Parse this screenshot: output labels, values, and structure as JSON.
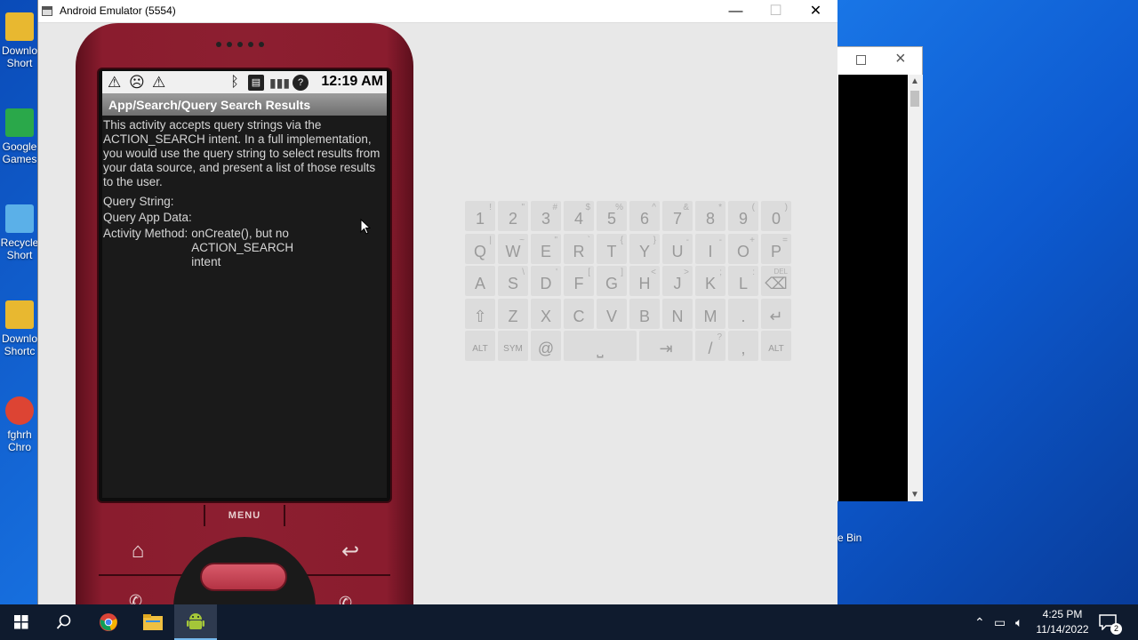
{
  "desktop": {
    "icons": [
      {
        "label1": "Downlo",
        "label2": "Short",
        "color": "#e8b830"
      },
      {
        "label1": "Google",
        "label2": "Games",
        "color": "#2aa84a"
      },
      {
        "label1": "Recycle",
        "label2": "Short",
        "color": "#5bb0e8"
      },
      {
        "label1": "Downlo",
        "label2": "Shortc",
        "color": "#e8b830"
      },
      {
        "label1": "fghrh",
        "label2": "Chro",
        "color": "#dd4433"
      }
    ],
    "recycle_label": "e Bin"
  },
  "emulator_window": {
    "title": "Android Emulator (5554)",
    "minimize": "—",
    "maximize": "☐",
    "close": "✕"
  },
  "phone": {
    "status": {
      "time": "12:19 AM",
      "left_icons": [
        "warning-icon",
        "sad-face-icon",
        "warning-icon"
      ],
      "right_icons": [
        "bluetooth-icon",
        "sim-icon",
        "signal-icon",
        "unknown-icon"
      ]
    },
    "title": "App/Search/Query Search Results",
    "description": "This activity accepts query strings via the ACTION_SEARCH intent. In a full implementation, you would use the query string to select results from your data source, and present a list of those results to the user.",
    "query_string_label": "Query String:",
    "query_string_value": "",
    "app_data_label": "Query App Data:",
    "app_data_value": "",
    "method_label": "Activity Method:",
    "method_value": "onCreate(), but no ACTION_SEARCH intent",
    "menu_label": "MENU",
    "home_glyph": "⌂",
    "back_glyph": "↩"
  },
  "keyboard": {
    "rows": [
      [
        {
          "m": "1",
          "a": "!"
        },
        {
          "m": "2",
          "a": "\""
        },
        {
          "m": "3",
          "a": "#"
        },
        {
          "m": "4",
          "a": "$"
        },
        {
          "m": "5",
          "a": "%"
        },
        {
          "m": "6",
          "a": "^"
        },
        {
          "m": "7",
          "a": "&"
        },
        {
          "m": "8",
          "a": "*"
        },
        {
          "m": "9",
          "a": "("
        },
        {
          "m": "0",
          "a": ")"
        }
      ],
      [
        {
          "m": "Q",
          "a": "|"
        },
        {
          "m": "W",
          "a": "~"
        },
        {
          "m": "E",
          "a": "\""
        },
        {
          "m": "R",
          "a": "`"
        },
        {
          "m": "T",
          "a": "{"
        },
        {
          "m": "Y",
          "a": "}"
        },
        {
          "m": "U",
          "a": "-"
        },
        {
          "m": "I",
          "a": "-"
        },
        {
          "m": "O",
          "a": "+"
        },
        {
          "m": "P",
          "a": "="
        }
      ],
      [
        {
          "m": "A",
          "a": ""
        },
        {
          "m": "S",
          "a": "\\"
        },
        {
          "m": "D",
          "a": "'"
        },
        {
          "m": "F",
          "a": "["
        },
        {
          "m": "G",
          "a": "]"
        },
        {
          "m": "H",
          "a": "<"
        },
        {
          "m": "J",
          "a": ">"
        },
        {
          "m": "K",
          "a": ";"
        },
        {
          "m": "L",
          "a": ":"
        },
        {
          "m": "⌫",
          "a": "DEL"
        }
      ],
      [
        {
          "m": "⇧",
          "a": ""
        },
        {
          "m": "Z",
          "a": ""
        },
        {
          "m": "X",
          "a": ""
        },
        {
          "m": "C",
          "a": ""
        },
        {
          "m": "V",
          "a": ""
        },
        {
          "m": "B",
          "a": ""
        },
        {
          "m": "N",
          "a": ""
        },
        {
          "m": "M",
          "a": ""
        },
        {
          "m": ".",
          "a": ""
        },
        {
          "m": "↵",
          "a": ""
        }
      ],
      [
        {
          "m": "ALT",
          "a": ""
        },
        {
          "m": "SYM",
          "a": ""
        },
        {
          "m": "@",
          "a": ""
        },
        {
          "m": "⎵",
          "a": ""
        },
        {
          "m": "⇥",
          "a": ""
        },
        {
          "m": "/",
          "a": "?"
        },
        {
          "m": ",",
          "a": ""
        },
        {
          "m": "ALT",
          "a": ""
        }
      ]
    ]
  },
  "taskbar": {
    "time": "4:25 PM",
    "date": "11/14/2022",
    "notification_count": "2"
  }
}
